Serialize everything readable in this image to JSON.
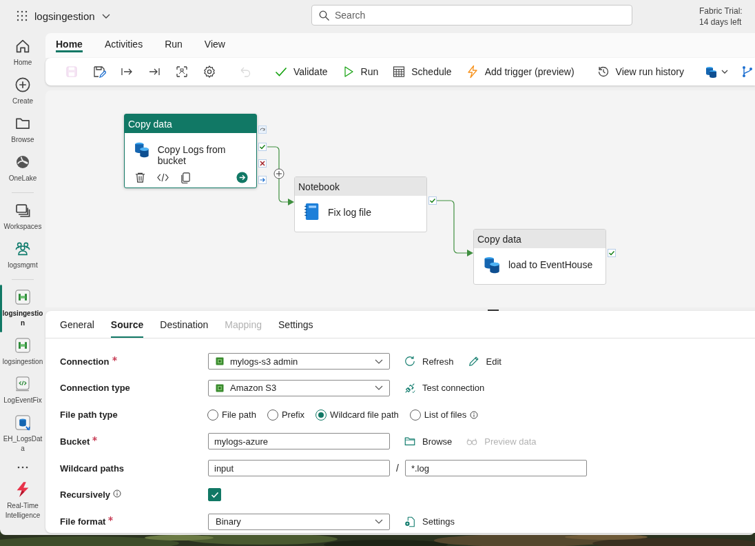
{
  "app_bar": {
    "title": "logsingestion",
    "search": {
      "placeholder": "Search"
    },
    "trial_title": "Fabric Trial:",
    "trial_days": "14 days left"
  },
  "nav": {
    "groups": [
      {
        "items": [
          {
            "kind": "home",
            "label": "Home",
            "selected": false
          },
          {
            "kind": "create",
            "label": "Create",
            "selected": false
          },
          {
            "kind": "browse",
            "label": "Browse",
            "selected": false
          },
          {
            "kind": "onelake",
            "label": "OneLake",
            "selected": false
          }
        ]
      },
      {
        "items": [
          {
            "kind": "workspaces",
            "label": "Workspaces",
            "selected": false
          },
          {
            "kind": "group",
            "label": "logsmgmt",
            "selected": false
          }
        ]
      },
      {
        "items": [
          {
            "kind": "pipeline",
            "label": "logsingestion",
            "selected": true
          },
          {
            "kind": "pipeline",
            "label": "logsingestion",
            "selected": false
          },
          {
            "kind": "notebook",
            "label": "LogEventFix",
            "selected": false
          },
          {
            "kind": "eventhouse",
            "label": "EH_LogsData",
            "selected": false
          },
          {
            "kind": "more",
            "selected": false
          },
          {
            "kind": "rti",
            "label": "Real-Time Intelligence",
            "selected": false
          }
        ]
      }
    ]
  },
  "ribbon": {
    "tabs": [
      {
        "label": "Home",
        "selected": true
      },
      {
        "label": "Activities",
        "selected": false
      },
      {
        "label": "Run",
        "selected": false
      },
      {
        "label": "View",
        "selected": false
      }
    ],
    "toolbar": {
      "groups": [
        {
          "items": [
            {
              "kind": "save",
              "disabled": true
            },
            {
              "kind": "save_as",
              "disabled": false
            },
            {
              "kind": "run_from",
              "disabled": false
            },
            {
              "kind": "run_to",
              "disabled": false
            },
            {
              "kind": "autoalign",
              "disabled": false
            },
            {
              "kind": "settings",
              "disabled": false
            }
          ]
        },
        {
          "items": [
            {
              "kind": "undo",
              "disabled": true
            }
          ]
        },
        {
          "items": [
            {
              "kind": "validate",
              "label": "Validate",
              "disabled": false
            },
            {
              "kind": "run",
              "label": "Run",
              "disabled": false
            },
            {
              "kind": "schedule",
              "label": "Schedule",
              "disabled": false
            },
            {
              "kind": "trigger",
              "label": "Add trigger (preview)",
              "disabled": false
            }
          ]
        },
        {
          "items": [
            {
              "kind": "history",
              "label": "View run history",
              "disabled": false
            }
          ]
        },
        {
          "items": [
            {
              "kind": "datasource",
              "disabled": false
            },
            {
              "kind": "branch",
              "disabled": false
            }
          ]
        }
      ]
    }
  },
  "canvas": {
    "activities": [
      {
        "kind": "copy",
        "type": "Copy data",
        "name": "Copy Logs from bucket",
        "selected": true
      },
      {
        "kind": "notebook",
        "type": "Notebook",
        "name": "Fix log file",
        "selected": false
      },
      {
        "kind": "copy",
        "type": "Copy data",
        "name": "load to EventHouse",
        "selected": false
      }
    ]
  },
  "panel": {
    "tabs": [
      {
        "label": "General",
        "selected": false,
        "disabled": false
      },
      {
        "label": "Source",
        "selected": true,
        "disabled": false
      },
      {
        "label": "Destination",
        "selected": false,
        "disabled": false
      },
      {
        "label": "Mapping",
        "selected": false,
        "disabled": true
      },
      {
        "label": "Settings",
        "selected": false,
        "disabled": false
      }
    ],
    "fields": [
      {
        "kind": "connection",
        "label": "Connection",
        "required": true,
        "value": "mylogs-s3 admin",
        "actions": [
          {
            "kind": "refresh",
            "label": "Refresh",
            "disabled": false
          },
          {
            "kind": "edit",
            "label": "Edit",
            "disabled": false
          }
        ]
      },
      {
        "kind": "connection",
        "label": "Connection type",
        "required": false,
        "value": "Amazon S3",
        "actions": [
          {
            "kind": "test",
            "label": "Test connection",
            "disabled": false
          }
        ]
      },
      {
        "kind": "radio",
        "label": "File path type",
        "required": false,
        "options": [
          {
            "label": "File path",
            "selected": false,
            "info": false
          },
          {
            "label": "Prefix",
            "selected": false,
            "info": false
          },
          {
            "label": "Wildcard file path",
            "selected": true,
            "info": false
          },
          {
            "label": "List of files",
            "selected": false,
            "info": true
          }
        ]
      },
      {
        "kind": "text",
        "label": "Bucket",
        "required": true,
        "value": "mylogs-azure",
        "actions": [
          {
            "kind": "browse",
            "label": "Browse",
            "disabled": false
          },
          {
            "kind": "preview",
            "label": "Preview data",
            "disabled": true
          }
        ]
      },
      {
        "kind": "path",
        "label": "Wildcard paths",
        "required": false,
        "folder": "input",
        "separator": "/",
        "file": "*.log"
      },
      {
        "kind": "checkbox",
        "label": "Recursively",
        "required": false,
        "info": true,
        "checked": true
      },
      {
        "kind": "select",
        "label": "File format",
        "required": true,
        "value": "Binary",
        "actions": [
          {
            "kind": "format_settings",
            "label": "Settings",
            "disabled": false
          }
        ]
      }
    ]
  }
}
